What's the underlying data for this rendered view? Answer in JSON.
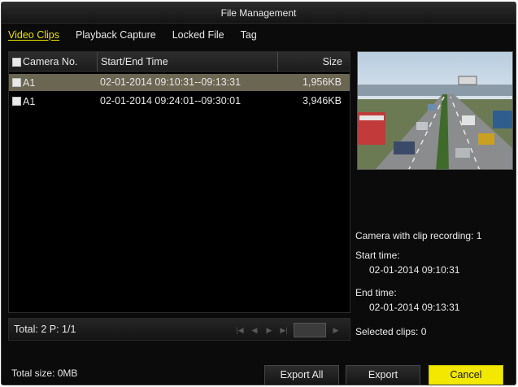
{
  "window": {
    "title": "File Management"
  },
  "tabs": [
    {
      "label": "Video Clips",
      "active": true
    },
    {
      "label": "Playback Capture",
      "active": false
    },
    {
      "label": "Locked File",
      "active": false
    },
    {
      "label": "Tag",
      "active": false
    }
  ],
  "table": {
    "columns": {
      "camera": "Camera No.",
      "time": "Start/End Time",
      "size": "Size"
    },
    "rows": [
      {
        "camera": "A1",
        "time": "02-01-2014 09:10:31--09:13:31",
        "size": "1,956KB",
        "selected": true
      },
      {
        "camera": "A1",
        "time": "02-01-2014 09:24:01--09:30:01",
        "size": "3,946KB",
        "selected": false
      }
    ]
  },
  "status": {
    "totals": "Total: 2  P: 1/1"
  },
  "info": {
    "camera_recording": "Camera with clip recording: 1",
    "start_label": "Start time:",
    "start_value": "02-01-2014 09:10:31",
    "end_label": "End time:",
    "end_value": "02-01-2014 09:13:31",
    "selected_clips": "Selected clips: 0"
  },
  "footer": {
    "total_size": "Total size: 0MB",
    "export_all": "Export All",
    "export": "Export",
    "cancel": "Cancel"
  },
  "colors": {
    "accent_yellow": "#f2e800",
    "selected_row": "#6b6652",
    "background": "#0b0b0b"
  }
}
